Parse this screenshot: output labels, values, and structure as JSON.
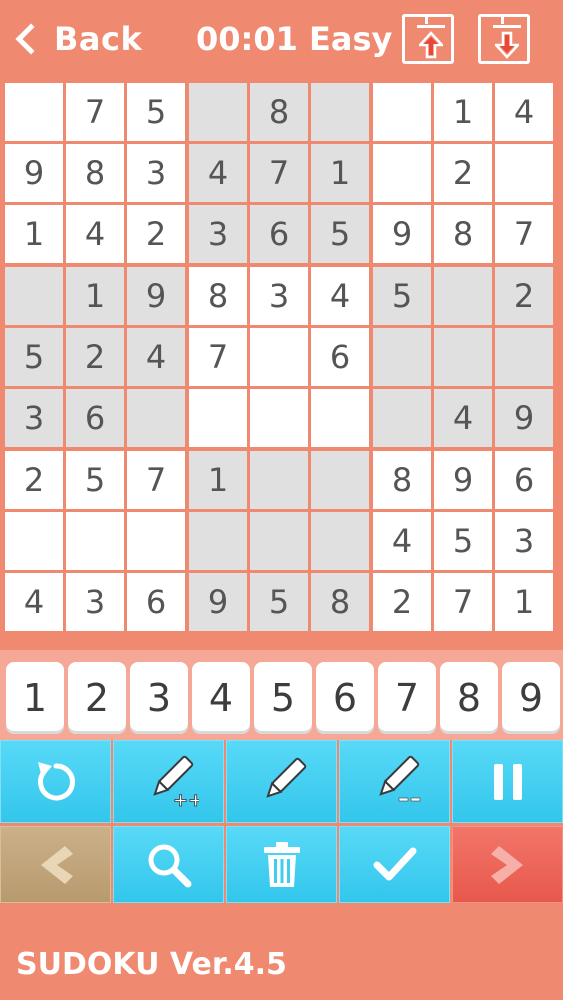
{
  "header": {
    "back_label": "Back",
    "timer": "00:01",
    "difficulty": "Easy"
  },
  "board": {
    "rows": [
      [
        "",
        "7",
        "5",
        "",
        "8",
        "",
        "",
        "1",
        "4"
      ],
      [
        "9",
        "8",
        "3",
        "4",
        "7",
        "1",
        "",
        "2",
        ""
      ],
      [
        "1",
        "4",
        "2",
        "3",
        "6",
        "5",
        "9",
        "8",
        "7"
      ],
      [
        "",
        "1",
        "9",
        "8",
        "3",
        "4",
        "5",
        "",
        "2"
      ],
      [
        "5",
        "2",
        "4",
        "7",
        "",
        "6",
        "",
        "",
        ""
      ],
      [
        "3",
        "6",
        "",
        "",
        "",
        "",
        "",
        "4",
        "9"
      ],
      [
        "2",
        "5",
        "7",
        "1",
        "",
        "",
        "8",
        "9",
        "6"
      ],
      [
        "",
        "",
        "",
        "",
        "",
        "",
        "4",
        "5",
        "3"
      ],
      [
        "4",
        "3",
        "6",
        "9",
        "5",
        "8",
        "2",
        "7",
        "1"
      ]
    ]
  },
  "numpad": {
    "keys": [
      "1",
      "2",
      "3",
      "4",
      "5",
      "6",
      "7",
      "8",
      "9"
    ]
  },
  "colors": {
    "background": "#ef8a71",
    "cell_white": "#ffffff",
    "cell_gray": "#e0e0e0",
    "tool_blue": "#3fcdf0",
    "prev_tan": "#c2a67c",
    "next_red": "#ec6558"
  },
  "footer": {
    "version": "SUDOKU Ver.4.5"
  }
}
